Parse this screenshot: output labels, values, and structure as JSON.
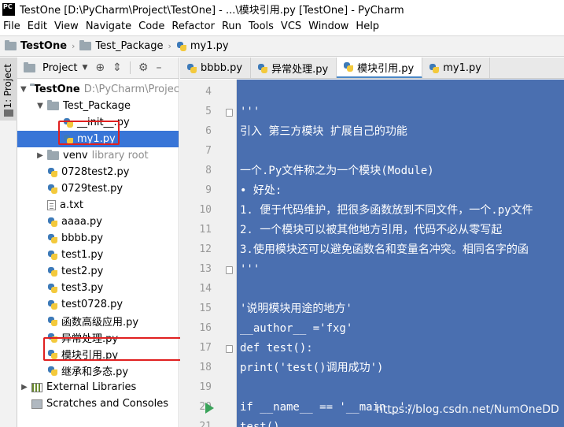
{
  "window": {
    "logo_text": "PC",
    "title": "TestOne [D:\\PyCharm\\Project\\TestOne] - ...\\模块引用.py [TestOne] - PyCharm"
  },
  "menu": [
    "File",
    "Edit",
    "View",
    "Navigate",
    "Code",
    "Refactor",
    "Run",
    "Tools",
    "VCS",
    "Window",
    "Help"
  ],
  "breadcrumb": {
    "items": [
      "TestOne",
      "Test_Package",
      "my1.py"
    ],
    "separator": "›"
  },
  "tool_strip": {
    "project_label": "1: Project"
  },
  "project_panel": {
    "title": "Project",
    "caret": "▼",
    "tree": [
      {
        "label": "TestOne",
        "detail": "D:\\PyCharm\\Project\\TestOne",
        "type": "folder",
        "arrow": "▼",
        "indent": 0,
        "bold": true
      },
      {
        "label": "Test_Package",
        "type": "folder",
        "arrow": "▼",
        "indent": 1
      },
      {
        "label": "__init__.py",
        "type": "py",
        "indent": 2
      },
      {
        "label": "my1.py",
        "type": "py",
        "indent": 2,
        "selected": true
      },
      {
        "label": "venv",
        "detail": "library root",
        "type": "folder",
        "arrow": "▶",
        "indent": 1
      },
      {
        "label": "0728test2.py",
        "type": "py",
        "indent": 1
      },
      {
        "label": "0729test.py",
        "type": "py",
        "indent": 1
      },
      {
        "label": "a.txt",
        "type": "txt",
        "indent": 1
      },
      {
        "label": "aaaa.py",
        "type": "py",
        "indent": 1
      },
      {
        "label": "bbbb.py",
        "type": "py",
        "indent": 1
      },
      {
        "label": "test1.py",
        "type": "py",
        "indent": 1
      },
      {
        "label": "test2.py",
        "type": "py",
        "indent": 1
      },
      {
        "label": "test3.py",
        "type": "py",
        "indent": 1
      },
      {
        "label": "test0728.py",
        "type": "py",
        "indent": 1
      },
      {
        "label": "函数高级应用.py",
        "type": "py",
        "indent": 1
      },
      {
        "label": "异常处理.py",
        "type": "py",
        "indent": 1
      },
      {
        "label": "模块引用.py",
        "type": "py",
        "indent": 1
      },
      {
        "label": "继承和多态.py",
        "type": "py",
        "indent": 1
      },
      {
        "label": "External Libraries",
        "type": "lib",
        "arrow": "▶",
        "indent": 0
      },
      {
        "label": "Scratches and Consoles",
        "type": "console",
        "indent": 0
      }
    ]
  },
  "tabs": [
    {
      "label": "bbbb.py",
      "active": false
    },
    {
      "label": "异常处理.py",
      "active": false
    },
    {
      "label": "模块引用.py",
      "active": true
    },
    {
      "label": "my1.py",
      "active": false
    }
  ],
  "editor": {
    "lines": [
      {
        "no": "4",
        "text": ""
      },
      {
        "no": "5",
        "text": "'''"
      },
      {
        "no": "6",
        "text": "引入 第三方模块 扩展自己的功能"
      },
      {
        "no": "7",
        "text": ""
      },
      {
        "no": "8",
        "text": "一个.Py文件称之为一个模块(Module)"
      },
      {
        "no": "9",
        "text": "• 好处:"
      },
      {
        "no": "10",
        "text": "1. 便于代码维护，把很多函数放到不同文件，一个.py文件"
      },
      {
        "no": "11",
        "text": "2. 一个模块可以被其他地方引用，代码不必从零写起"
      },
      {
        "no": "12",
        "text": "3.使用模块还可以避免函数名和变量名冲突。相同名字的函"
      },
      {
        "no": "13",
        "text": "'''"
      },
      {
        "no": "14",
        "text": ""
      },
      {
        "no": "15",
        "text": "'说明模块用途的地方'"
      },
      {
        "no": "16",
        "text": "__author__ ='fxg'"
      },
      {
        "no": "17",
        "text": "def test():"
      },
      {
        "no": "18",
        "text": "    print('test()调用成功')"
      },
      {
        "no": "19",
        "text": ""
      },
      {
        "no": "20",
        "text": "if __name__ == '__main__':"
      },
      {
        "no": "21",
        "text": "    test()"
      }
    ]
  },
  "watermark": "https://blog.csdn.net/NumOneDD",
  "colors": {
    "selection": "#3875d7",
    "editor_selection_bg": "#4a6fb0",
    "highlight_box": "#e02020",
    "run_icon": "#3aa35a"
  }
}
